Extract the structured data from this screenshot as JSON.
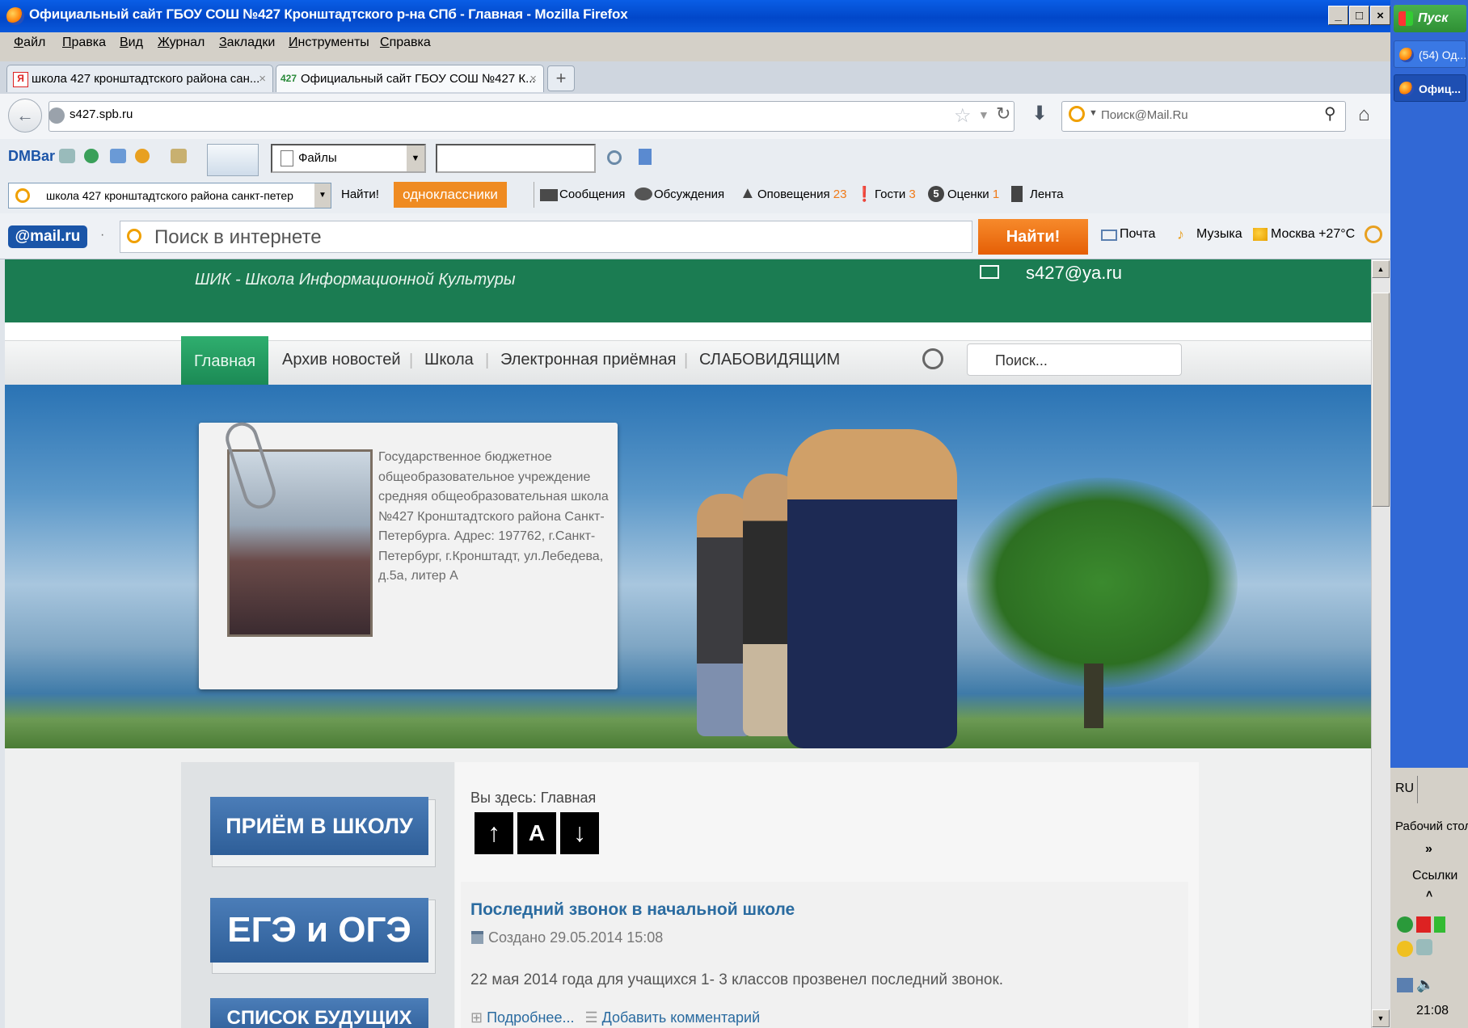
{
  "window": {
    "title": "Официальный сайт ГБОУ СОШ №427 Кронштадтского р-на СПб - Главная - Mozilla Firefox",
    "controls": [
      "_",
      "□",
      "×"
    ]
  },
  "menu": [
    "Файл",
    "Правка",
    "Вид",
    "Журнал",
    "Закладки",
    "Инструменты",
    "Справка"
  ],
  "tabs": [
    {
      "favicon": "Я",
      "label": "школа 427 кронштадтского района сан...",
      "close": "×"
    },
    {
      "favicon": "427",
      "label": "Официальный сайт ГБОУ СОШ №427 К...",
      "close": "×"
    }
  ],
  "new_tab": "+",
  "address": {
    "url": "s427.spb.ru"
  },
  "search_box": {
    "value": "Поиск@Mail.Ru"
  },
  "dmbar": {
    "logo": "DMBar",
    "dropdown_value": "Файлы",
    "input_value": ""
  },
  "okbar": {
    "query": "школа 427 кронштадтского района санкт-петер",
    "find": "Найти!",
    "brand": "одноклассники",
    "messages": "Сообщения",
    "discussions": "Обсуждения",
    "alerts": "Оповещения",
    "alerts_count": "23",
    "guests": "Гости",
    "guests_count": "3",
    "ratings": "Оценки",
    "ratings_count": "1",
    "feed": "Лента"
  },
  "mailru": {
    "logo": "@mail.ru",
    "placeholder": "Поиск в интернете",
    "find": "Найти!",
    "mail": "Почта",
    "music": "Музыка",
    "weather": "Москва +27°C"
  },
  "site": {
    "tagline": "ШИК - Школа Информационной Культуры",
    "email": "s427@ya.ru",
    "nav": [
      "Главная",
      "Архив новостей",
      "Школа",
      "Электронная приёмная",
      "СЛАБОВИДЯЩИМ"
    ],
    "search_placeholder": "Поиск...",
    "school_info": "Государственное бюджетное общеобразовательное учреждение средняя общеобразовательная школа №427 Кронштадтского района Санкт-Петербурга. Адрес: 197762, г.Санкт-Петербург, г.Кронштадт, ул.Лебедева, д.5а, литер А",
    "side_buttons": [
      "ПРИЁМ В ШКОЛУ",
      "ЕГЭ и ОГЭ",
      "СПИСОК БУДУЩИХ"
    ],
    "breadcrumb": "Вы здесь: Главная",
    "font_controls": [
      "↑",
      "A",
      "↓"
    ],
    "article": {
      "title": "Последний звонок в начальной школе",
      "created": "Создано 29.05.2014 15:08",
      "text": "22 мая 2014 года для учащихся 1- 3 классов прозвенел последний звонок.",
      "more": "Подробнее...",
      "comment": "Добавить комментарий"
    }
  },
  "taskbar": {
    "start": "Пуск",
    "items": [
      "(54) Од...",
      "Офиц..."
    ],
    "lang": "RU",
    "desktop": "Рабочий стол",
    "more": "»",
    "links": "Ссылки",
    "collapse": "˄",
    "time": "21:08"
  },
  "colors": {
    "title_blue": "#0a58da",
    "site_green": "#1a7d51",
    "orange": "#ef6c0e",
    "link_blue": "#2a6ba0"
  }
}
